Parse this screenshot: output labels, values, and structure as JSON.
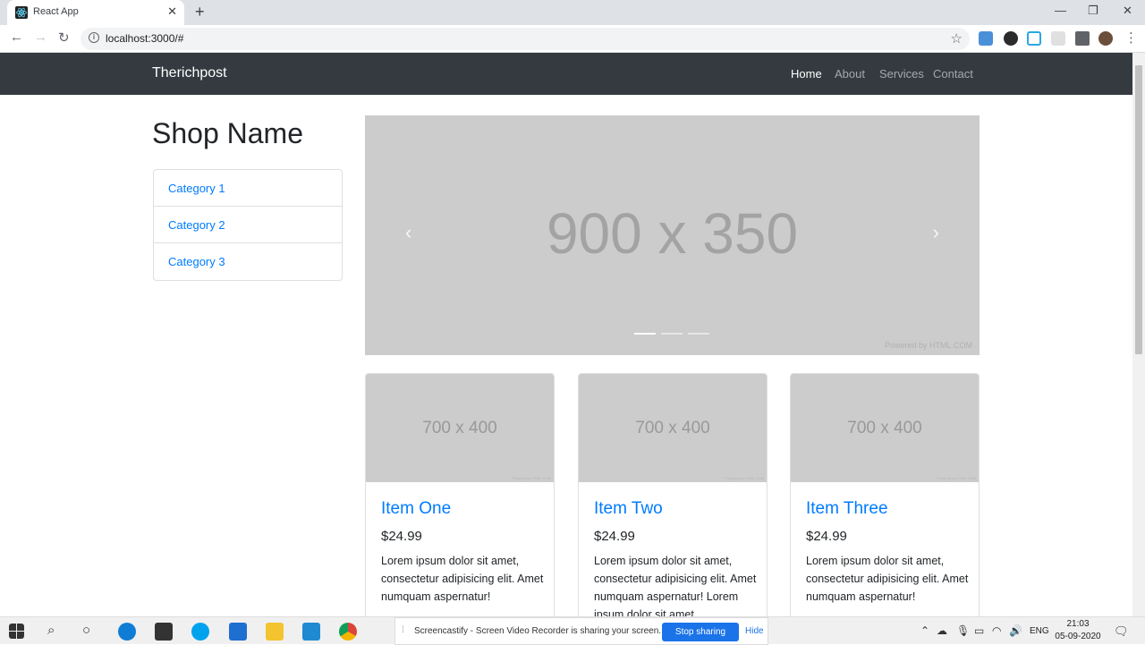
{
  "browser": {
    "tab_title": "React App",
    "url": "localhost:3000/#"
  },
  "navbar": {
    "brand": "Therichpost",
    "links": [
      "Home",
      "About",
      "Services",
      "Contact"
    ]
  },
  "sidebar": {
    "shop_name": "Shop Name",
    "categories": [
      "Category 1",
      "Category 2",
      "Category 3"
    ]
  },
  "carousel": {
    "placeholder": "900 x 350",
    "powered": "Powered by HTML.COM",
    "slides": 3,
    "active_slide": 1
  },
  "cards": [
    {
      "placeholder": "700 x 400",
      "title": "Item One",
      "price": "$24.99",
      "desc": "Lorem ipsum dolor sit amet, consectetur adipisicing elit. Amet numquam aspernatur!"
    },
    {
      "placeholder": "700 x 400",
      "title": "Item Two",
      "price": "$24.99",
      "desc": "Lorem ipsum dolor sit amet, consectetur adipisicing elit. Amet numquam aspernatur! Lorem ipsum dolor sit amet."
    },
    {
      "placeholder": "700 x 400",
      "title": "Item Three",
      "price": "$24.99",
      "desc": "Lorem ipsum dolor sit amet, consectetur adipisicing elit. Amet numquam aspernatur!"
    }
  ],
  "taskbar": {
    "share_message": "Screencastify - Screen Video Recorder is sharing your screen.",
    "stop_label": "Stop sharing",
    "hide_label": "Hide",
    "language": "ENG",
    "time": "21:03",
    "date": "05-09-2020"
  },
  "colors": {
    "navbar_bg": "#343a40",
    "link_blue": "#007bff",
    "placeholder_gray": "#cccccc"
  }
}
